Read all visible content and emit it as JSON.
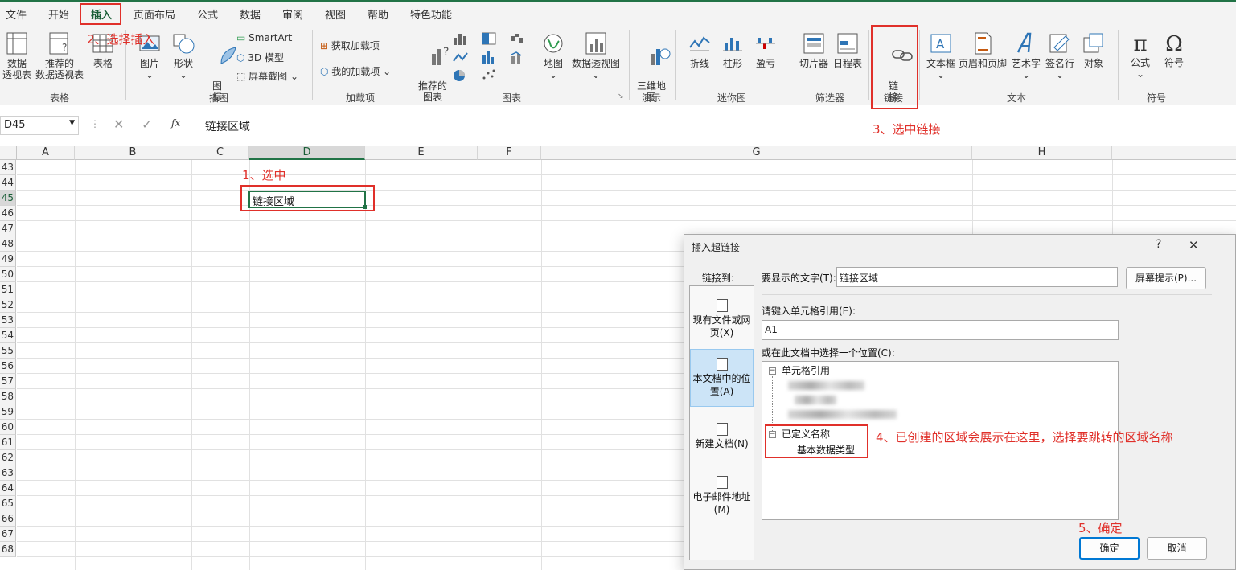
{
  "menu": {
    "tabs": [
      "文件",
      "开始",
      "插入",
      "页面布局",
      "公式",
      "数据",
      "审阅",
      "视图",
      "帮助",
      "特色功能"
    ],
    "active_tab": "插入"
  },
  "ribbon": {
    "table_group": {
      "label": "表格",
      "pivot": "数据\n透视表",
      "recommended_pivot": "推荐的\n数据透视表",
      "table": "表格"
    },
    "illustrations_group": {
      "label": "插图",
      "picture": "图片",
      "shapes": "形状",
      "icons": "图\n标",
      "smartart": "SmartArt",
      "model3d": "3D 模型",
      "screenshot": "屏幕截图"
    },
    "addins_group": {
      "label": "加载项",
      "get_addins": "获取加载项",
      "my_addins": "我的加载项"
    },
    "charts_group": {
      "label": "图表",
      "recommended": "推荐的\n图表",
      "maps": "地图",
      "pivot_chart": "数据透视图"
    },
    "tour_group": {
      "label": "演示",
      "map3d": "三维地\n图"
    },
    "sparkline_group": {
      "label": "迷你图",
      "line": "折线",
      "column": "柱形",
      "winloss": "盈亏"
    },
    "filter_group": {
      "label": "筛选器",
      "slicer": "切片器",
      "timeline": "日程表"
    },
    "link_group": {
      "label": "链接",
      "link": "链\n接"
    },
    "text_group": {
      "label": "文本",
      "textbox": "文本框",
      "header_footer": "页眉和页脚",
      "wordart": "艺术字",
      "signature": "签名行",
      "object": "对象"
    },
    "symbol_group": {
      "label": "符号",
      "equation": "公式",
      "symbol": "符号"
    },
    "equation_glyph": "π",
    "symbol_glyph": "Ω"
  },
  "formula_bar": {
    "name_box": "D45",
    "fx": "fx",
    "content": "链接区域"
  },
  "sheet": {
    "columns": [
      "A",
      "B",
      "C",
      "D",
      "E",
      "F",
      "G",
      "H"
    ],
    "rows": [
      "43",
      "44",
      "45",
      "46",
      "47",
      "48",
      "49",
      "50",
      "51",
      "52",
      "53",
      "54",
      "55",
      "56",
      "57",
      "58",
      "59",
      "60",
      "61",
      "62",
      "63",
      "64",
      "65",
      "66",
      "67",
      "68"
    ],
    "selected_cell_value": "链接区域"
  },
  "dialog": {
    "title": "插入超链接",
    "help": "?",
    "close": "✕",
    "link_to_label": "链接到:",
    "link_to_items": [
      "现有文件或网页(X)",
      "本文档中的位置(A)",
      "新建文档(N)",
      "电子邮件地址(M)"
    ],
    "display_text_label": "要显示的文字(T):",
    "display_text_value": "链接区域",
    "screen_tip": "屏幕提示(P)...",
    "cell_ref_label": "请键入单元格引用(E):",
    "cell_ref_value": "A1",
    "place_label": "或在此文档中选择一个位置(C):",
    "tree_cell_refs": "单元格引用",
    "tree_defined_names": "已定义名称",
    "tree_name_item": "基本数据类型",
    "ok": "确定",
    "cancel": "取消"
  },
  "annotations": {
    "step1": "1、选中",
    "step2": "2、选择插入",
    "step3": "3、选中链接",
    "step4": "4、已创建的区域会展示在这里，选择要跳转的区域名称",
    "step5": "5、确定"
  },
  "colors": {
    "accent": "#217346",
    "annotation": "#e0302a",
    "selection": "#cce4f7",
    "default_button": "#0078d4"
  }
}
